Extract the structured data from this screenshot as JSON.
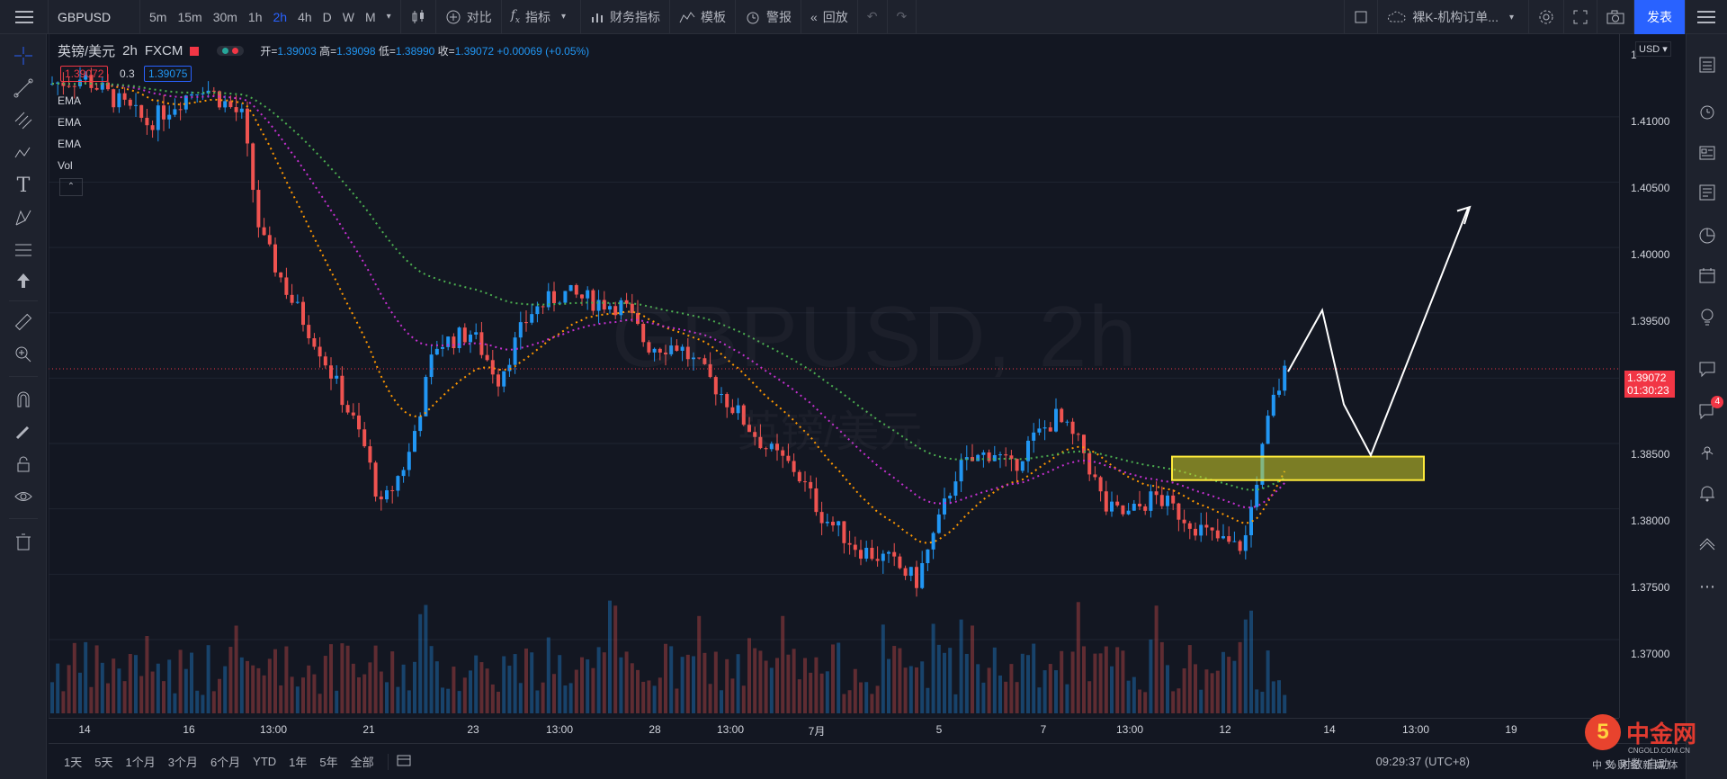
{
  "toolbar": {
    "symbol": "GBPUSD",
    "intervals": [
      "5m",
      "15m",
      "30m",
      "1h",
      "2h",
      "4h",
      "D",
      "W",
      "M"
    ],
    "active_interval": "2h",
    "compare_label": "对比",
    "indicators_label": "指标",
    "financials_label": "财务指标",
    "templates_label": "模板",
    "alert_label": "警报",
    "replay_label": "回放",
    "layout_name": "裸K-机构订单...",
    "publish_label": "发表"
  },
  "legend": {
    "name": "英镑/美元",
    "interval": "2h",
    "source": "FXCM",
    "open_label": "开",
    "open": "1.39003",
    "high_label": "高",
    "high": "1.39098",
    "low_label": "低",
    "low": "1.38990",
    "close_label": "收",
    "close": "1.39072",
    "change": "+0.00069 (+0.05%)",
    "bid": "1.39072",
    "spread": "0.3",
    "ask": "1.39075",
    "indicators": [
      "EMA",
      "EMA",
      "EMA",
      "Vol"
    ]
  },
  "watermark": {
    "line1": "GBPUSD, 2h",
    "line2": "英镑/美元"
  },
  "y_axis": {
    "currency": "USD",
    "labels": [
      "1.41000",
      "1.40500",
      "1.40000",
      "1.39500",
      "1.39000",
      "1.38500",
      "1.38000",
      "1.37500",
      "1.37000"
    ],
    "top_partial": "1",
    "current_price": "1.39072",
    "countdown": "01:30:23"
  },
  "x_axis": {
    "labels": [
      "14",
      "16",
      "13:00",
      "21",
      "23",
      "13:00",
      "28",
      "13:00",
      "7月",
      "5",
      "7",
      "13:00",
      "12",
      "14",
      "13:00",
      "19"
    ]
  },
  "bottom": {
    "ranges": [
      "1天",
      "5天",
      "1个月",
      "3个月",
      "6个月",
      "YTD",
      "1年",
      "5年",
      "全部"
    ],
    "clock": "09:29:37 (UTC+8)",
    "right_menu": "% 对数 自动"
  },
  "badge": {
    "count": "4"
  },
  "logo": {
    "name": "中金网",
    "site": "CNGOLD.COM.CN",
    "sub": "中 文 财 经 新 媒 体"
  },
  "chart_data": {
    "type": "candlestick",
    "symbol": "GBPUSD",
    "interval": "2h",
    "ylim": [
      1.368,
      1.415
    ],
    "candles_approx": [
      [
        1.414,
        1.415,
        1.4105,
        1.412
      ],
      [
        1.412,
        1.4135,
        1.4085,
        1.4095
      ],
      [
        1.4095,
        1.411,
        1.406,
        1.408
      ],
      [
        1.408,
        1.409,
        1.399,
        1.4
      ],
      [
        1.4,
        1.401,
        1.395,
        1.397
      ],
      [
        1.397,
        1.3975,
        1.39,
        1.3915
      ],
      [
        1.3915,
        1.393,
        1.387,
        1.388
      ],
      [
        1.388,
        1.389,
        1.38,
        1.382
      ],
      [
        1.382,
        1.386,
        1.38,
        1.385
      ],
      [
        1.385,
        1.394,
        1.384,
        1.393
      ],
      [
        1.393,
        1.3955,
        1.389,
        1.39
      ],
      [
        1.39,
        1.398,
        1.3895,
        1.3965
      ],
      [
        1.3965,
        1.4,
        1.395,
        1.3975
      ],
      [
        1.3975,
        1.3985,
        1.391,
        1.3925
      ],
      [
        1.3925,
        1.394,
        1.388,
        1.3895
      ],
      [
        1.3895,
        1.392,
        1.386,
        1.387
      ],
      [
        1.387,
        1.3905,
        1.384,
        1.385
      ],
      [
        1.385,
        1.386,
        1.377,
        1.379
      ],
      [
        1.379,
        1.38,
        1.374,
        1.376
      ],
      [
        1.376,
        1.385,
        1.3755,
        1.384
      ],
      [
        1.384,
        1.388,
        1.383,
        1.386
      ],
      [
        1.386,
        1.39,
        1.3845,
        1.388
      ],
      [
        1.388,
        1.389,
        1.379,
        1.381
      ],
      [
        1.381,
        1.383,
        1.376,
        1.3775
      ],
      [
        1.3775,
        1.38,
        1.375,
        1.377
      ],
      [
        1.377,
        1.386,
        1.376,
        1.385
      ],
      [
        1.385,
        1.391,
        1.3845,
        1.3905
      ]
    ]
  }
}
